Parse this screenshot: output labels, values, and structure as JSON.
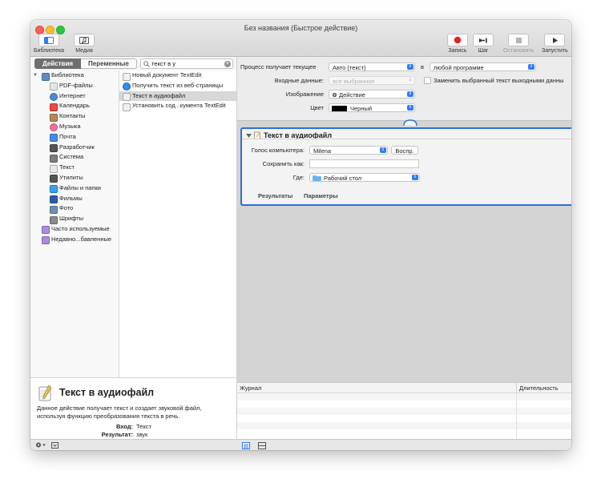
{
  "window": {
    "title": "Без названия (Быстрое действие)"
  },
  "toolbar": {
    "library": "Библиотека",
    "media": "Медиа",
    "record": "Запись",
    "step": "Шаг",
    "stop": "Остановить",
    "run": "Запустить"
  },
  "library_panel": {
    "tab_actions": "Действия",
    "tab_variables": "Переменные",
    "search_value": "текст в у",
    "library_items": [
      {
        "label": "Библиотека",
        "icon": "library-icon"
      },
      {
        "label": "PDF-файлы",
        "icon": "pdf-icon"
      },
      {
        "label": "Интернет",
        "icon": "globe-icon"
      },
      {
        "label": "Календарь",
        "icon": "calendar-icon"
      },
      {
        "label": "Контакты",
        "icon": "contacts-icon"
      },
      {
        "label": "Музыка",
        "icon": "music-icon"
      },
      {
        "label": "Почта",
        "icon": "mail-icon"
      },
      {
        "label": "Разработчик",
        "icon": "developer-icon"
      },
      {
        "label": "Система",
        "icon": "system-icon"
      },
      {
        "label": "Текст",
        "icon": "text-icon"
      },
      {
        "label": "Утилиты",
        "icon": "utilities-icon"
      },
      {
        "label": "Файлы и папки",
        "icon": "finder-icon"
      },
      {
        "label": "Фильмы",
        "icon": "movies-icon"
      },
      {
        "label": "Фото",
        "icon": "photos-icon"
      },
      {
        "label": "Шрифты",
        "icon": "fonts-icon"
      },
      {
        "label": "Часто используемые",
        "icon": "smart-folder-icon"
      },
      {
        "label": "Недавно...бавленные",
        "icon": "smart-folder-icon"
      }
    ],
    "action_items": [
      {
        "label": "Новый документ TextEdit",
        "icon": "textedit-icon"
      },
      {
        "label": "Получить текст из веб-страницы",
        "icon": "safari-icon"
      },
      {
        "label": "Текст в аудиофайл",
        "icon": "textedit-icon"
      },
      {
        "label": "Установить сод...кумента TextEdit",
        "icon": "textedit-icon"
      }
    ]
  },
  "description": {
    "title": "Текст в аудиофайл",
    "text": "Данное действие получает текст и создает звуковой файл, используя функцию преобразования текста в речь.",
    "input_label": "Вход:",
    "input_value": "Текст",
    "result_label": "Результат:",
    "result_value": "звук"
  },
  "workflow_settings": {
    "receives_label": "Процесс получает текущее",
    "receives_value": "Авто (текст)",
    "in_label": "в",
    "app_value": "любой программе",
    "input_label": "Входные данные:",
    "input_value": "все выбранное",
    "replace_label": "Заменить выбранный текст выходными данны",
    "image_label": "Изображение",
    "image_value": "Действие",
    "color_label": "Цвет",
    "color_value": "Черный"
  },
  "action": {
    "title": "Текст в аудиофайл",
    "voice_label": "Голос компьютера:",
    "voice_value": "Milena",
    "play_button": "Воспр.",
    "save_as_label": "Сохранить как:",
    "save_as_value": "",
    "where_label": "Где:",
    "where_value": "Рабочий стол",
    "tab_results": "Результаты",
    "tab_options": "Параметры"
  },
  "log": {
    "col_log": "Журнал",
    "col_duration": "Длительность"
  },
  "colors": {
    "accent": "#2f7cf6",
    "record": "#e0242b"
  }
}
